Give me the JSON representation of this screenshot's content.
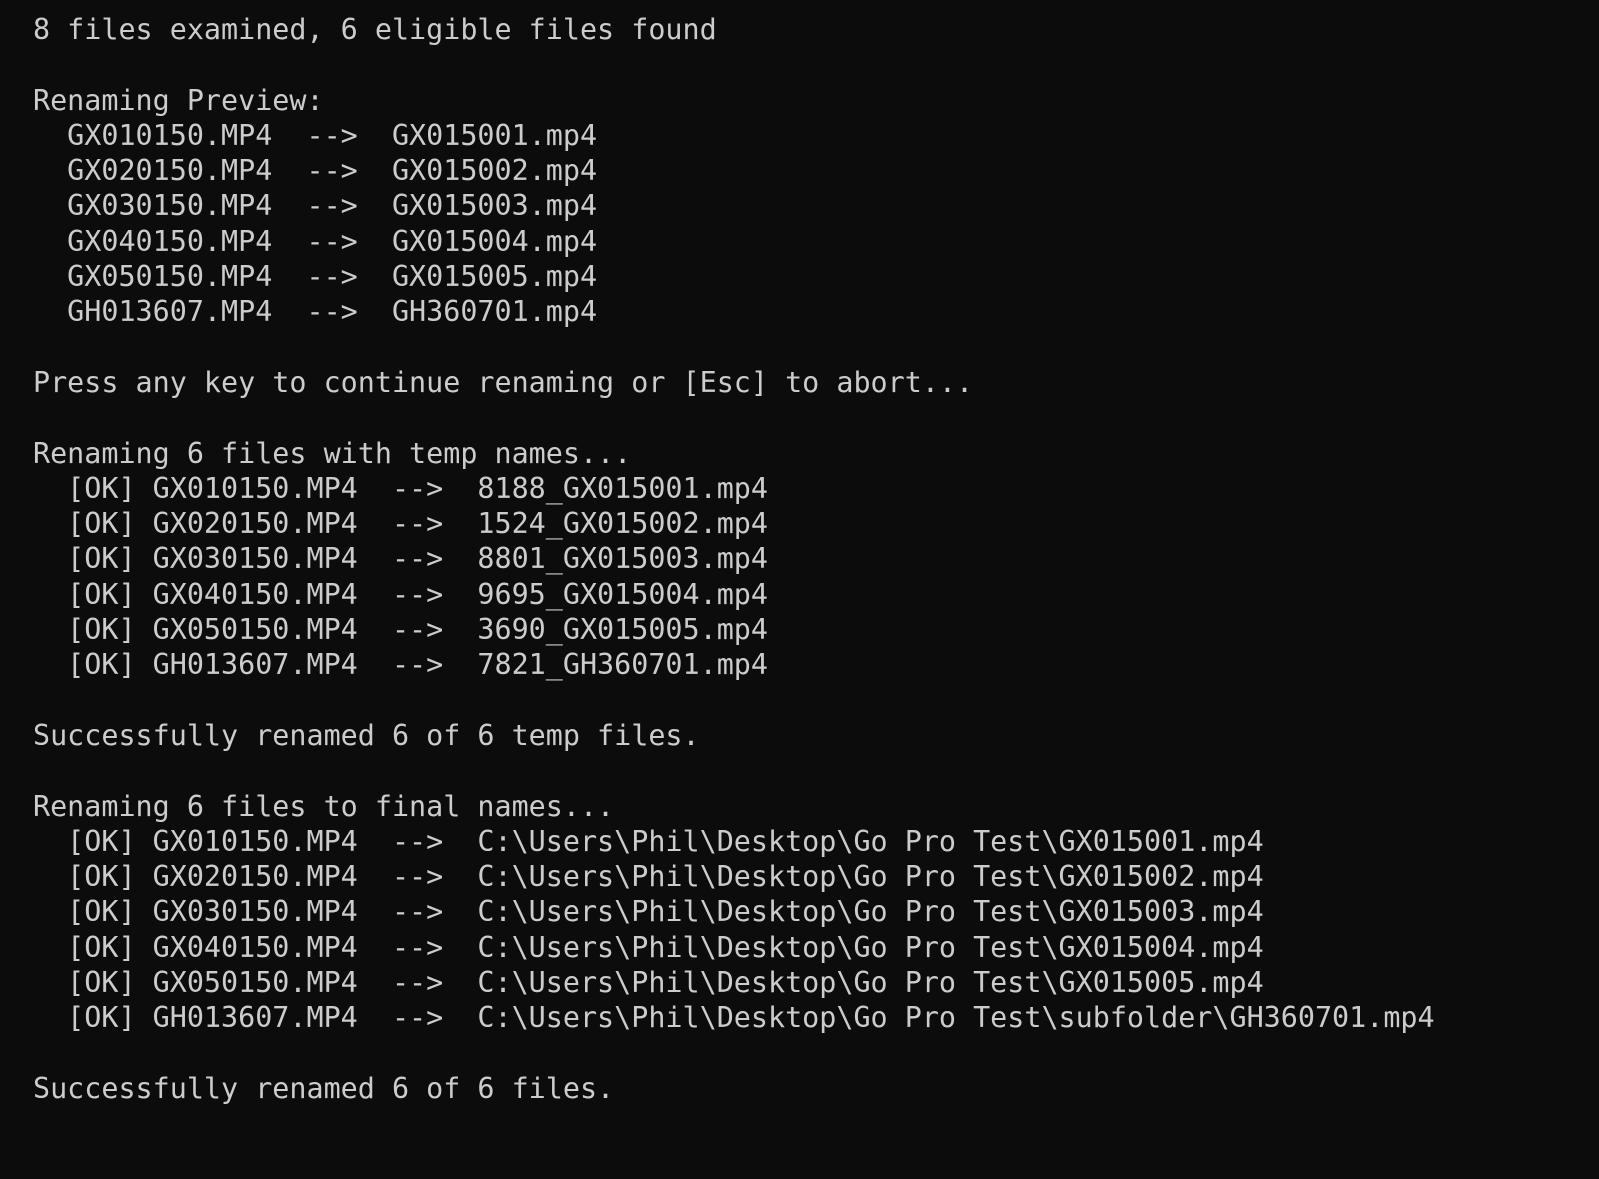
{
  "terminal": {
    "background_color": "#0c0c0c",
    "text_color": "#cccccc",
    "summary_examined": "8 files examined, 6 eligible files found",
    "preview_heading": "Renaming Preview:",
    "preview_rows": [
      "  GX010150.MP4  -->  GX015001.mp4",
      "  GX020150.MP4  -->  GX015002.mp4",
      "  GX030150.MP4  -->  GX015003.mp4",
      "  GX040150.MP4  -->  GX015004.mp4",
      "  GX050150.MP4  -->  GX015005.mp4",
      "  GH013607.MP4  -->  GH360701.mp4"
    ],
    "prompt": "Press any key to continue renaming or [Esc] to abort...",
    "temp_heading": "Renaming 6 files with temp names...",
    "temp_rows": [
      "  [OK] GX010150.MP4  -->  8188_GX015001.mp4",
      "  [OK] GX020150.MP4  -->  1524_GX015002.mp4",
      "  [OK] GX030150.MP4  -->  8801_GX015003.mp4",
      "  [OK] GX040150.MP4  -->  9695_GX015004.mp4",
      "  [OK] GX050150.MP4  -->  3690_GX015005.mp4",
      "  [OK] GH013607.MP4  -->  7821_GH360701.mp4"
    ],
    "temp_result": "Successfully renamed 6 of 6 temp files.",
    "final_heading": "Renaming 6 files to final names...",
    "final_rows": [
      "  [OK] GX010150.MP4  -->  C:\\Users\\Phil\\Desktop\\Go Pro Test\\GX015001.mp4",
      "  [OK] GX020150.MP4  -->  C:\\Users\\Phil\\Desktop\\Go Pro Test\\GX015002.mp4",
      "  [OK] GX030150.MP4  -->  C:\\Users\\Phil\\Desktop\\Go Pro Test\\GX015003.mp4",
      "  [OK] GX040150.MP4  -->  C:\\Users\\Phil\\Desktop\\Go Pro Test\\GX015004.mp4",
      "  [OK] GX050150.MP4  -->  C:\\Users\\Phil\\Desktop\\Go Pro Test\\GX015005.mp4",
      "  [OK] GH013607.MP4  -->  C:\\Users\\Phil\\Desktop\\Go Pro Test\\subfolder\\GH360701.mp4"
    ],
    "final_result": "Successfully renamed 6 of 6 files."
  }
}
